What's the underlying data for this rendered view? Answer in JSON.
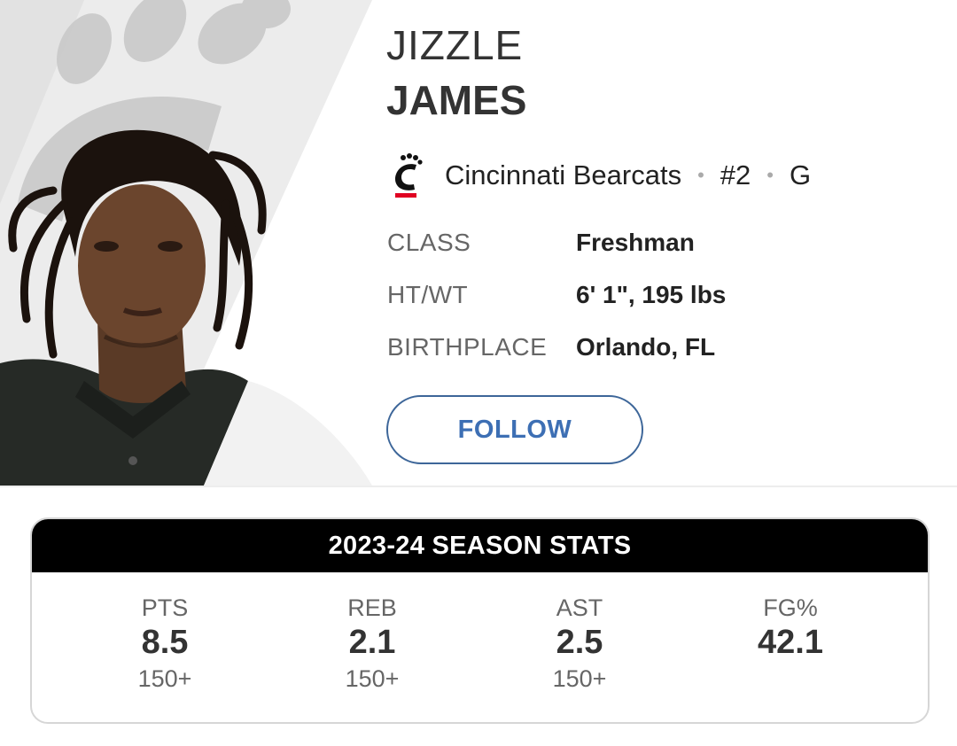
{
  "player": {
    "first_name": "JIZZLE",
    "last_name": "JAMES",
    "team": "Cincinnati Bearcats",
    "number": "#2",
    "position": "G",
    "team_logo_icon": "bearcats-c-logo-icon"
  },
  "bio": [
    {
      "label": "CLASS",
      "value": "Freshman"
    },
    {
      "label": "HT/WT",
      "value": "6' 1\", 195 lbs"
    },
    {
      "label": "BIRTHPLACE",
      "value": "Orlando, FL"
    }
  ],
  "follow_label": "FOLLOW",
  "season_stats": {
    "title": "2023-24 SEASON STATS",
    "stats": [
      {
        "label": "PTS",
        "value": "8.5",
        "rank": "150+"
      },
      {
        "label": "REB",
        "value": "2.1",
        "rank": "150+"
      },
      {
        "label": "AST",
        "value": "2.5",
        "rank": "150+"
      },
      {
        "label": "FG%",
        "value": "42.1",
        "rank": ""
      }
    ]
  },
  "colors": {
    "accent": "#3d6fb4",
    "team_red": "#e00122",
    "header_bg": "#000000"
  }
}
